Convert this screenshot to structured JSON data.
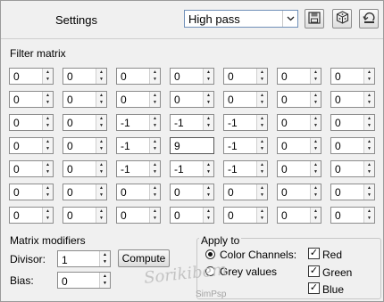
{
  "header": {
    "settings_label": "Settings",
    "preset_value": "High pass"
  },
  "toolbar": {
    "icons": [
      "save-icon",
      "randomize-icon",
      "reset-icon"
    ]
  },
  "filter_matrix": {
    "title": "Filter matrix",
    "rows": [
      [
        "0",
        "0",
        "0",
        "0",
        "0",
        "0",
        "0"
      ],
      [
        "0",
        "0",
        "0",
        "0",
        "0",
        "0",
        "0"
      ],
      [
        "0",
        "0",
        "-1",
        "-1",
        "-1",
        "0",
        "0"
      ],
      [
        "0",
        "0",
        "-1",
        "9",
        "-1",
        "0",
        "0"
      ],
      [
        "0",
        "0",
        "-1",
        "-1",
        "-1",
        "0",
        "0"
      ],
      [
        "0",
        "0",
        "0",
        "0",
        "0",
        "0",
        "0"
      ],
      [
        "0",
        "0",
        "0",
        "0",
        "0",
        "0",
        "0"
      ]
    ]
  },
  "modifiers": {
    "title": "Matrix modifiers",
    "divisor_label": "Divisor:",
    "divisor_value": "1",
    "compute_label": "Compute",
    "bias_label": "Bias:",
    "bias_value": "0"
  },
  "apply_to": {
    "title": "Apply to",
    "color_channels_label": "Color Channels:",
    "color_channels_selected": true,
    "grey_values_label": "Grey values",
    "grey_values_selected": false,
    "channels": [
      {
        "label": "Red",
        "checked": true
      },
      {
        "label": "Green",
        "checked": true
      },
      {
        "label": "Blue",
        "checked": true
      }
    ]
  },
  "watermark": {
    "signature": "Sorikibem",
    "subtext": "SimPsp"
  }
}
